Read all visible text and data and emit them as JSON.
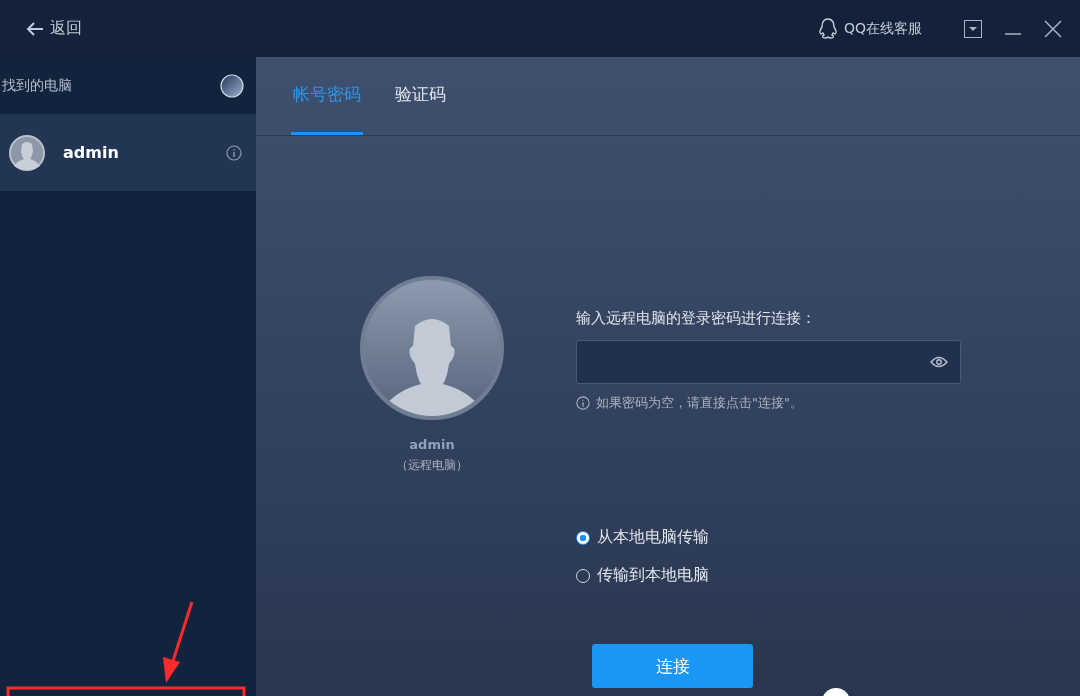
{
  "header": {
    "back": "返回",
    "support": "QQ在线客服"
  },
  "sidebar": {
    "title": "找到的电脑",
    "items": [
      {
        "name": "admin",
        "selected": true
      }
    ]
  },
  "tabs": [
    {
      "label": "帐号密码",
      "selected": true
    },
    {
      "label": "验证码",
      "selected": false
    }
  ],
  "remote": {
    "name": "admin",
    "caption": "（远程电脑）"
  },
  "password": {
    "label": "输入远程电脑的登录密码进行连接：",
    "hint": "如果密码为空，请直接点击\"连接\"。"
  },
  "transfer": [
    {
      "label": "从本地电脑传输",
      "selected": true
    },
    {
      "label": "传输到本地电脑",
      "selected": false
    }
  ],
  "connect_button": "连接",
  "annotation": {
    "kind": "arrow-box"
  }
}
